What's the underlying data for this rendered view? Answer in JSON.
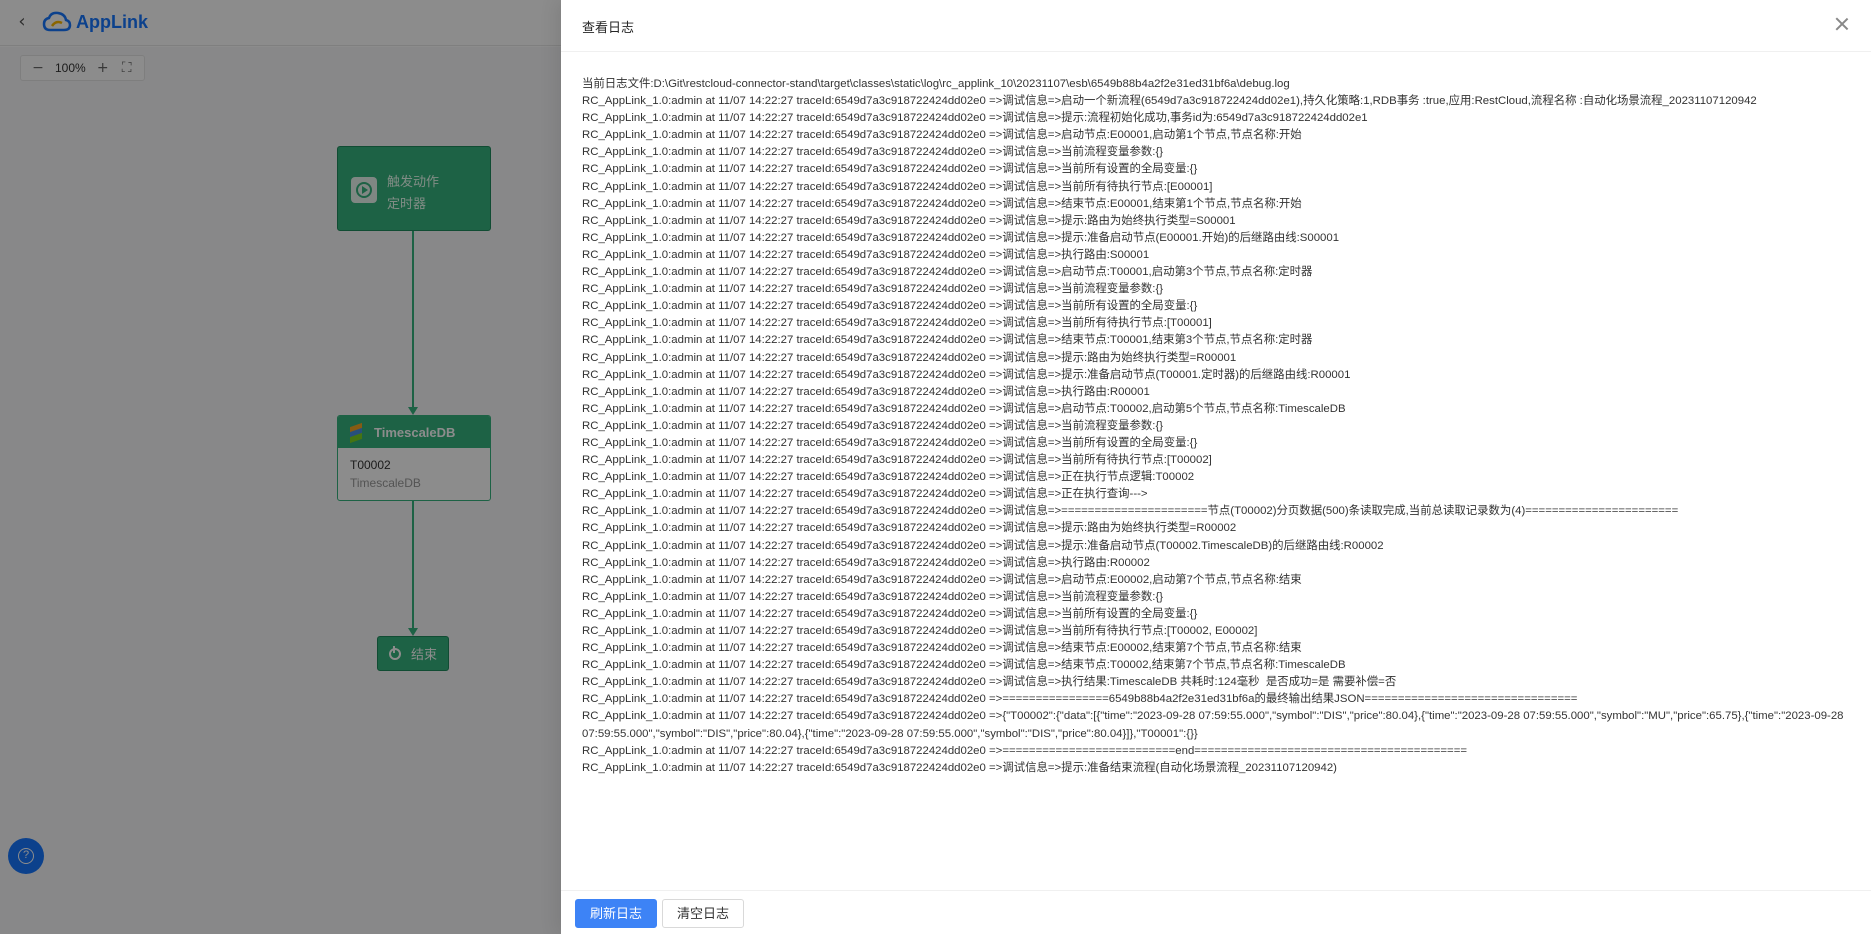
{
  "app": {
    "logo_text": "AppLink",
    "zoom_level": "100%",
    "zoom_out": "−",
    "zoom_in": "+"
  },
  "flow": {
    "trigger": {
      "line1": "触发动作",
      "line2": "定时器"
    },
    "db": {
      "title": "TimescaleDB",
      "code": "T00002",
      "sub": "TimescaleDB"
    },
    "end": {
      "label": "结束"
    }
  },
  "drawer": {
    "title": "查看日志",
    "log_lines": [
      "当前日志文件:D:\\Git\\restcloud-connector-stand\\target\\classes\\static\\log\\rc_applink_10\\20231107\\esb\\6549b88b4a2f2e31ed31bf6a\\debug.log",
      "RC_AppLink_1.0:admin at 11/07 14:22:27 traceId:6549d7a3c918722424dd02e0 =>调试信息=>启动一个新流程(6549d7a3c918722424dd02e1),持久化策略:1,RDB事务 :true,应用:RestCloud,流程名称 :自动化场景流程_20231107120942",
      "RC_AppLink_1.0:admin at 11/07 14:22:27 traceId:6549d7a3c918722424dd02e0 =>调试信息=>提示:流程初始化成功,事务id为:6549d7a3c918722424dd02e1",
      "RC_AppLink_1.0:admin at 11/07 14:22:27 traceId:6549d7a3c918722424dd02e0 =>调试信息=>启动节点:E00001,启动第1个节点,节点名称:开始",
      "RC_AppLink_1.0:admin at 11/07 14:22:27 traceId:6549d7a3c918722424dd02e0 =>调试信息=>当前流程变量参数:{}",
      "RC_AppLink_1.0:admin at 11/07 14:22:27 traceId:6549d7a3c918722424dd02e0 =>调试信息=>当前所有设置的全局变量:{}",
      "RC_AppLink_1.0:admin at 11/07 14:22:27 traceId:6549d7a3c918722424dd02e0 =>调试信息=>当前所有待执行节点:[E00001]",
      "RC_AppLink_1.0:admin at 11/07 14:22:27 traceId:6549d7a3c918722424dd02e0 =>调试信息=>结束节点:E00001,结束第1个节点,节点名称:开始",
      "RC_AppLink_1.0:admin at 11/07 14:22:27 traceId:6549d7a3c918722424dd02e0 =>调试信息=>提示:路由为始终执行类型=S00001",
      "RC_AppLink_1.0:admin at 11/07 14:22:27 traceId:6549d7a3c918722424dd02e0 =>调试信息=>提示:准备启动节点(E00001.开始)的后继路由线:S00001",
      "RC_AppLink_1.0:admin at 11/07 14:22:27 traceId:6549d7a3c918722424dd02e0 =>调试信息=>执行路由:S00001",
      "RC_AppLink_1.0:admin at 11/07 14:22:27 traceId:6549d7a3c918722424dd02e0 =>调试信息=>启动节点:T00001,启动第3个节点,节点名称:定时器",
      "RC_AppLink_1.0:admin at 11/07 14:22:27 traceId:6549d7a3c918722424dd02e0 =>调试信息=>当前流程变量参数:{}",
      "RC_AppLink_1.0:admin at 11/07 14:22:27 traceId:6549d7a3c918722424dd02e0 =>调试信息=>当前所有设置的全局变量:{}",
      "RC_AppLink_1.0:admin at 11/07 14:22:27 traceId:6549d7a3c918722424dd02e0 =>调试信息=>当前所有待执行节点:[T00001]",
      "RC_AppLink_1.0:admin at 11/07 14:22:27 traceId:6549d7a3c918722424dd02e0 =>调试信息=>结束节点:T00001,结束第3个节点,节点名称:定时器",
      "RC_AppLink_1.0:admin at 11/07 14:22:27 traceId:6549d7a3c918722424dd02e0 =>调试信息=>提示:路由为始终执行类型=R00001",
      "RC_AppLink_1.0:admin at 11/07 14:22:27 traceId:6549d7a3c918722424dd02e0 =>调试信息=>提示:准备启动节点(T00001.定时器)的后继路由线:R00001",
      "RC_AppLink_1.0:admin at 11/07 14:22:27 traceId:6549d7a3c918722424dd02e0 =>调试信息=>执行路由:R00001",
      "RC_AppLink_1.0:admin at 11/07 14:22:27 traceId:6549d7a3c918722424dd02e0 =>调试信息=>启动节点:T00002,启动第5个节点,节点名称:TimescaleDB",
      "RC_AppLink_1.0:admin at 11/07 14:22:27 traceId:6549d7a3c918722424dd02e0 =>调试信息=>当前流程变量参数:{}",
      "RC_AppLink_1.0:admin at 11/07 14:22:27 traceId:6549d7a3c918722424dd02e0 =>调试信息=>当前所有设置的全局变量:{}",
      "RC_AppLink_1.0:admin at 11/07 14:22:27 traceId:6549d7a3c918722424dd02e0 =>调试信息=>当前所有待执行节点:[T00002]",
      "RC_AppLink_1.0:admin at 11/07 14:22:27 traceId:6549d7a3c918722424dd02e0 =>调试信息=>正在执行节点逻辑:T00002",
      "RC_AppLink_1.0:admin at 11/07 14:22:27 traceId:6549d7a3c918722424dd02e0 =>调试信息=>正在执行查询--->",
      "RC_AppLink_1.0:admin at 11/07 14:22:27 traceId:6549d7a3c918722424dd02e0 =>调试信息=>======================节点(T00002)分页数据(500)条读取完成,当前总读取记录数为(4)=======================",
      "RC_AppLink_1.0:admin at 11/07 14:22:27 traceId:6549d7a3c918722424dd02e0 =>调试信息=>提示:路由为始终执行类型=R00002",
      "RC_AppLink_1.0:admin at 11/07 14:22:27 traceId:6549d7a3c918722424dd02e0 =>调试信息=>提示:准备启动节点(T00002.TimescaleDB)的后继路由线:R00002",
      "RC_AppLink_1.0:admin at 11/07 14:22:27 traceId:6549d7a3c918722424dd02e0 =>调试信息=>执行路由:R00002",
      "RC_AppLink_1.0:admin at 11/07 14:22:27 traceId:6549d7a3c918722424dd02e0 =>调试信息=>启动节点:E00002,启动第7个节点,节点名称:结束",
      "RC_AppLink_1.0:admin at 11/07 14:22:27 traceId:6549d7a3c918722424dd02e0 =>调试信息=>当前流程变量参数:{}",
      "RC_AppLink_1.0:admin at 11/07 14:22:27 traceId:6549d7a3c918722424dd02e0 =>调试信息=>当前所有设置的全局变量:{}",
      "RC_AppLink_1.0:admin at 11/07 14:22:27 traceId:6549d7a3c918722424dd02e0 =>调试信息=>当前所有待执行节点:[T00002, E00002]",
      "RC_AppLink_1.0:admin at 11/07 14:22:27 traceId:6549d7a3c918722424dd02e0 =>调试信息=>结束节点:E00002,结束第7个节点,节点名称:结束",
      "RC_AppLink_1.0:admin at 11/07 14:22:27 traceId:6549d7a3c918722424dd02e0 =>调试信息=>结束节点:T00002,结束第7个节点,节点名称:TimescaleDB",
      "RC_AppLink_1.0:admin at 11/07 14:22:27 traceId:6549d7a3c918722424dd02e0 =>调试信息=>执行结果:TimescaleDB 共耗时:124毫秒  是否成功=是 需要补偿=否",
      "RC_AppLink_1.0:admin at 11/07 14:22:27 traceId:6549d7a3c918722424dd02e0 =>================6549b88b4a2f2e31ed31bf6a的最终输出结果JSON================================",
      "RC_AppLink_1.0:admin at 11/07 14:22:27 traceId:6549d7a3c918722424dd02e0 =>{\"T00002\":{\"data\":[{\"time\":\"2023-09-28 07:59:55.000\",\"symbol\":\"DIS\",\"price\":80.04},{\"time\":\"2023-09-28 07:59:55.000\",\"symbol\":\"MU\",\"price\":65.75},{\"time\":\"2023-09-28 07:59:55.000\",\"symbol\":\"DIS\",\"price\":80.04},{\"time\":\"2023-09-28 07:59:55.000\",\"symbol\":\"DIS\",\"price\":80.04}]},\"T00001\":{}}",
      "RC_AppLink_1.0:admin at 11/07 14:22:27 traceId:6549d7a3c918722424dd02e0 =>==========================end=========================================",
      "RC_AppLink_1.0:admin at 11/07 14:22:27 traceId:6549d7a3c918722424dd02e0 =>调试信息=>提示:准备结束流程(自动化场景流程_20231107120942)"
    ],
    "buttons": {
      "refresh": "刷新日志",
      "clear": "清空日志"
    }
  },
  "colors": {
    "node_green": "#36b37e",
    "primary_blue": "#3d83f6",
    "brand_blue": "#1677ff"
  }
}
